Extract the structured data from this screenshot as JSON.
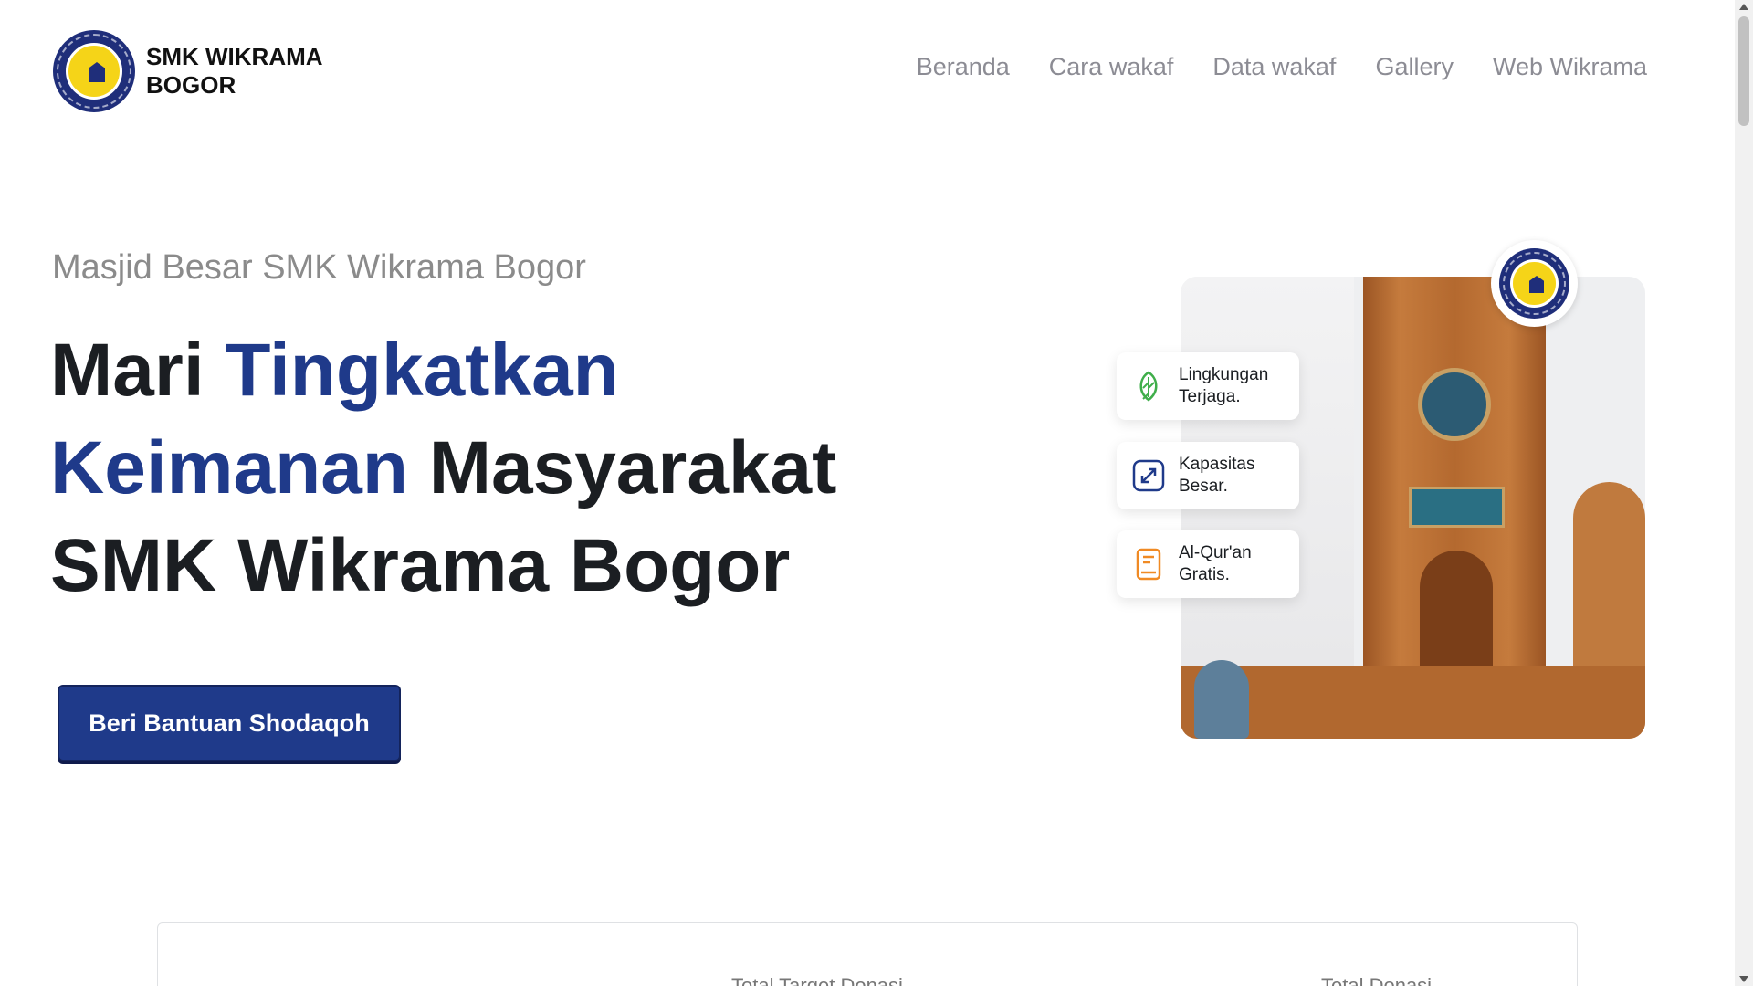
{
  "brand": {
    "line1": "SMK WIKRAMA",
    "line2": "BOGOR"
  },
  "nav": {
    "items": [
      {
        "label": "Beranda"
      },
      {
        "label": "Cara wakaf"
      },
      {
        "label": "Data wakaf"
      },
      {
        "label": "Gallery"
      },
      {
        "label": "Web Wikrama"
      }
    ]
  },
  "hero": {
    "subtitle": "Masjid Besar SMK Wikrama Bogor",
    "headline": {
      "part1": "Mari ",
      "highlight1": "Tingkatkan",
      "highlight2": "Keimanan",
      "part2": " Masyarakat",
      "part3": "SMK Wikrama Bogor"
    },
    "cta_label": "Beri Bantuan Shodaqoh"
  },
  "features": [
    {
      "line1": "Lingkungan",
      "line2": "Terjaga.",
      "icon": "leaf-icon",
      "color": "#3fae4a"
    },
    {
      "line1": "Kapasitas",
      "line2": "Besar.",
      "icon": "expand-icon",
      "color": "#1f3a8a"
    },
    {
      "line1": "Al-Qur'an",
      "line2": "Gratis.",
      "icon": "book-icon",
      "color": "#f08a24"
    }
  ],
  "stats": {
    "label1": "Total Target Donasi",
    "label2": "Total Donasi"
  },
  "colors": {
    "primary": "#1f3a8a",
    "nav_text": "#8c8c94",
    "logo_yellow": "#f5d418"
  }
}
